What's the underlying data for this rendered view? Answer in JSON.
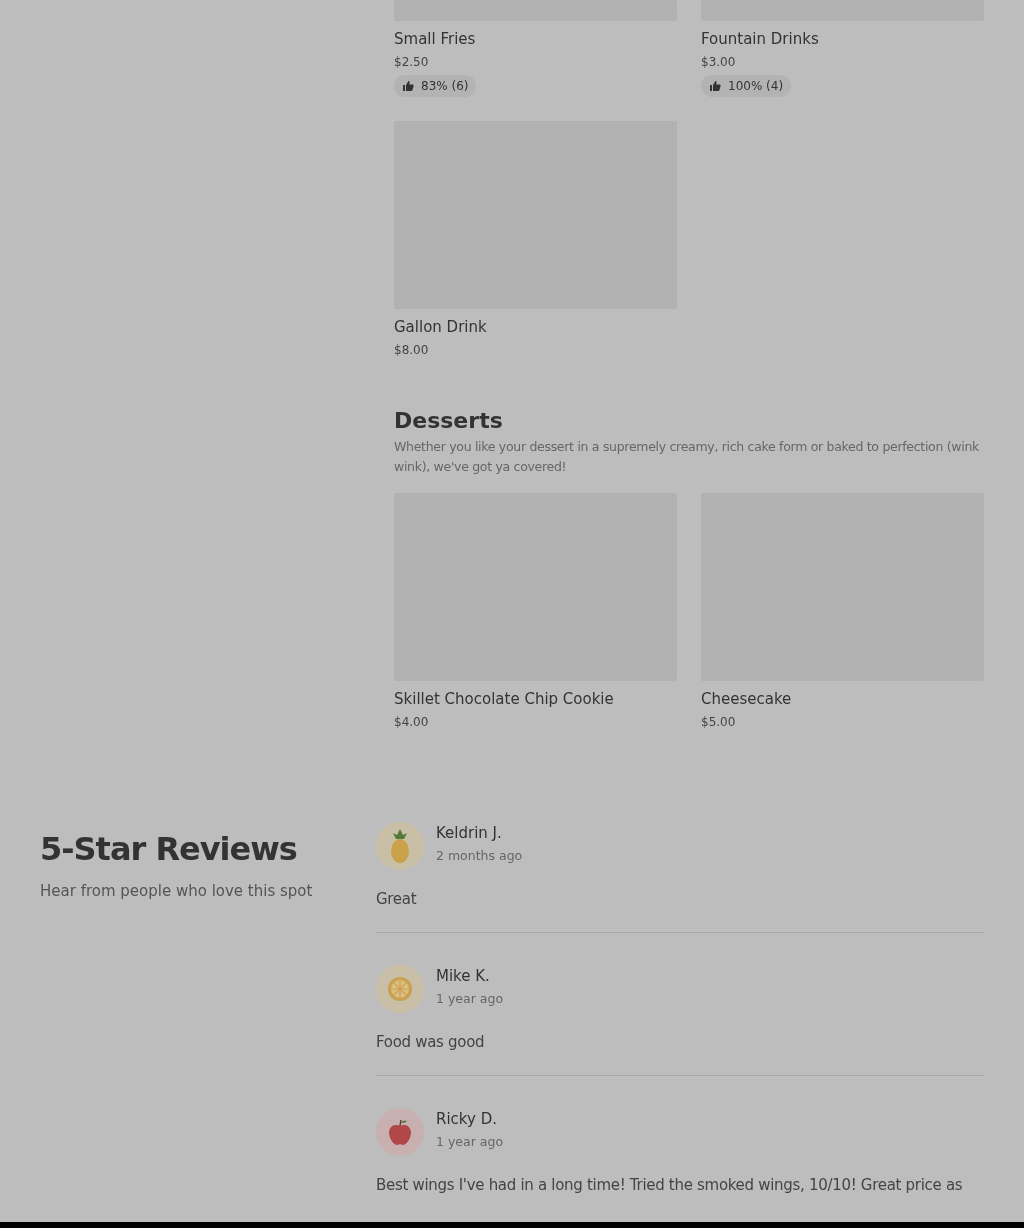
{
  "menu_items": [
    {
      "name": "Small Fries",
      "price": "$2.50",
      "rating": "83% (6)",
      "kind": "cut"
    },
    {
      "name": "Fountain Drinks",
      "price": "$3.00",
      "rating": "100% (4)",
      "kind": "cut"
    },
    {
      "name": "Gallon Drink",
      "price": "$8.00",
      "kind": "full"
    }
  ],
  "desserts": {
    "title": "Desserts",
    "description": "Whether you like your dessert in a supremely creamy, rich cake form or baked to perfection (wink wink), we've got ya covered!",
    "items": [
      {
        "name": "Skillet Chocolate Chip Cookie",
        "price": "$4.00"
      },
      {
        "name": "Cheesecake",
        "price": "$5.00"
      }
    ]
  },
  "reviews": {
    "title": "5-Star Reviews",
    "subtitle": "Hear from people who love this spot",
    "items": [
      {
        "kind": "pineapple",
        "name": "Keldrin J.",
        "time": "2 months ago",
        "text": "Great"
      },
      {
        "kind": "citrus",
        "name": "Mike K.",
        "time": "1 year ago",
        "text": "Food was good"
      },
      {
        "kind": "apple",
        "name": "Ricky D.",
        "time": "1 year ago",
        "text": "Best wings I've had in a long time! Tried the smoked wings, 10/10! Great price as"
      }
    ]
  }
}
